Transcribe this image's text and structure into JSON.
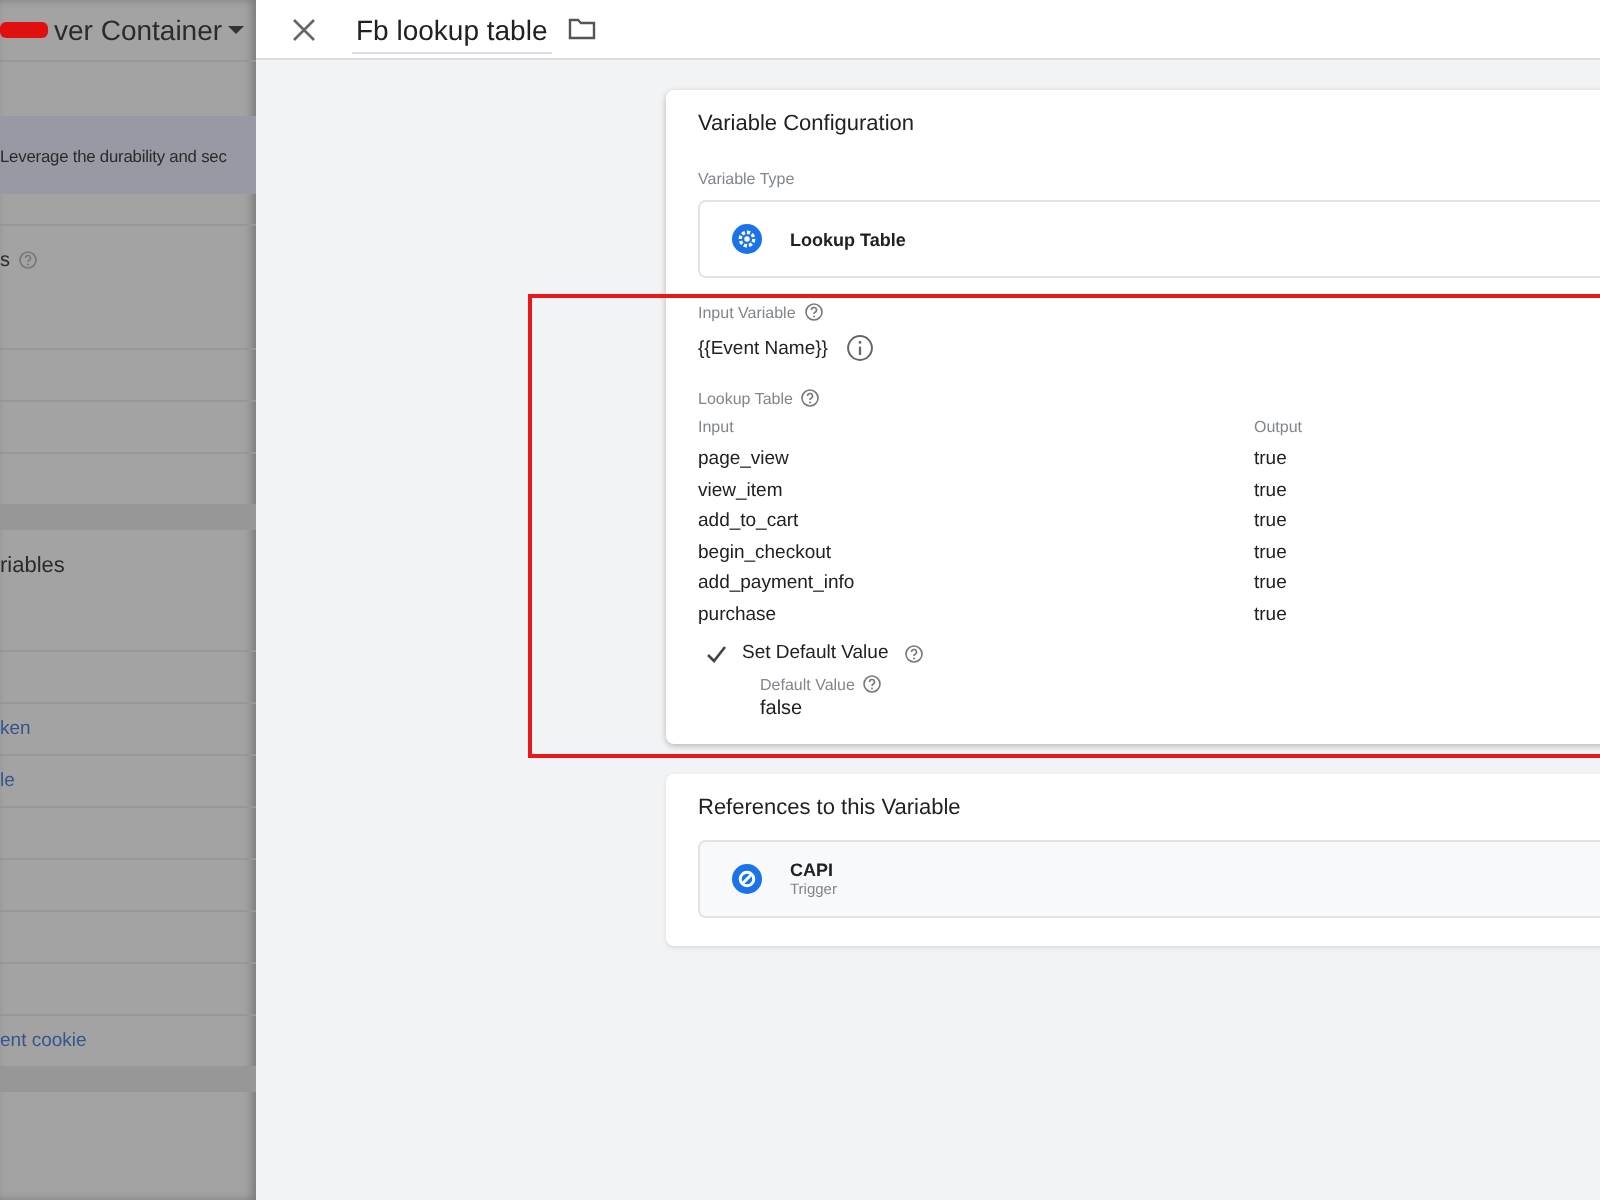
{
  "background_panel": {
    "container_name": "ver Container",
    "banner": "Leverage the durability and sec",
    "rows": [
      {
        "kind": "help-heading",
        "text": "s"
      },
      {
        "kind": "blank"
      },
      {
        "kind": "blank"
      },
      {
        "kind": "blank"
      },
      {
        "kind": "band"
      },
      {
        "kind": "heading",
        "text": "riables"
      },
      {
        "kind": "blank"
      },
      {
        "kind": "link",
        "text": "ken"
      },
      {
        "kind": "link",
        "text": "le"
      },
      {
        "kind": "blank"
      },
      {
        "kind": "blank"
      },
      {
        "kind": "blank"
      },
      {
        "kind": "blank"
      },
      {
        "kind": "link",
        "text": "ent cookie"
      },
      {
        "kind": "band"
      }
    ]
  },
  "header": {
    "title": "Fb lookup table"
  },
  "configuration": {
    "title": "Variable Configuration",
    "type_label": "Variable Type",
    "type_name": "Lookup Table",
    "input_label": "Input Variable",
    "input_value": "{{Event Name}}",
    "table_label": "Lookup Table",
    "columns": [
      "Input",
      "Output"
    ],
    "rows": [
      [
        "page_view",
        "true"
      ],
      [
        "view_item",
        "true"
      ],
      [
        "add_to_cart",
        "true"
      ],
      [
        "begin_checkout",
        "true"
      ],
      [
        "add_payment_info",
        "true"
      ],
      [
        "purchase",
        "true"
      ]
    ],
    "default": {
      "label": "Set Default Value",
      "checked": true,
      "value_label": "Default Value",
      "value": "false"
    }
  },
  "references": {
    "title": "References to this Variable",
    "items": [
      {
        "name": "CAPI",
        "type": "Trigger"
      }
    ]
  }
}
